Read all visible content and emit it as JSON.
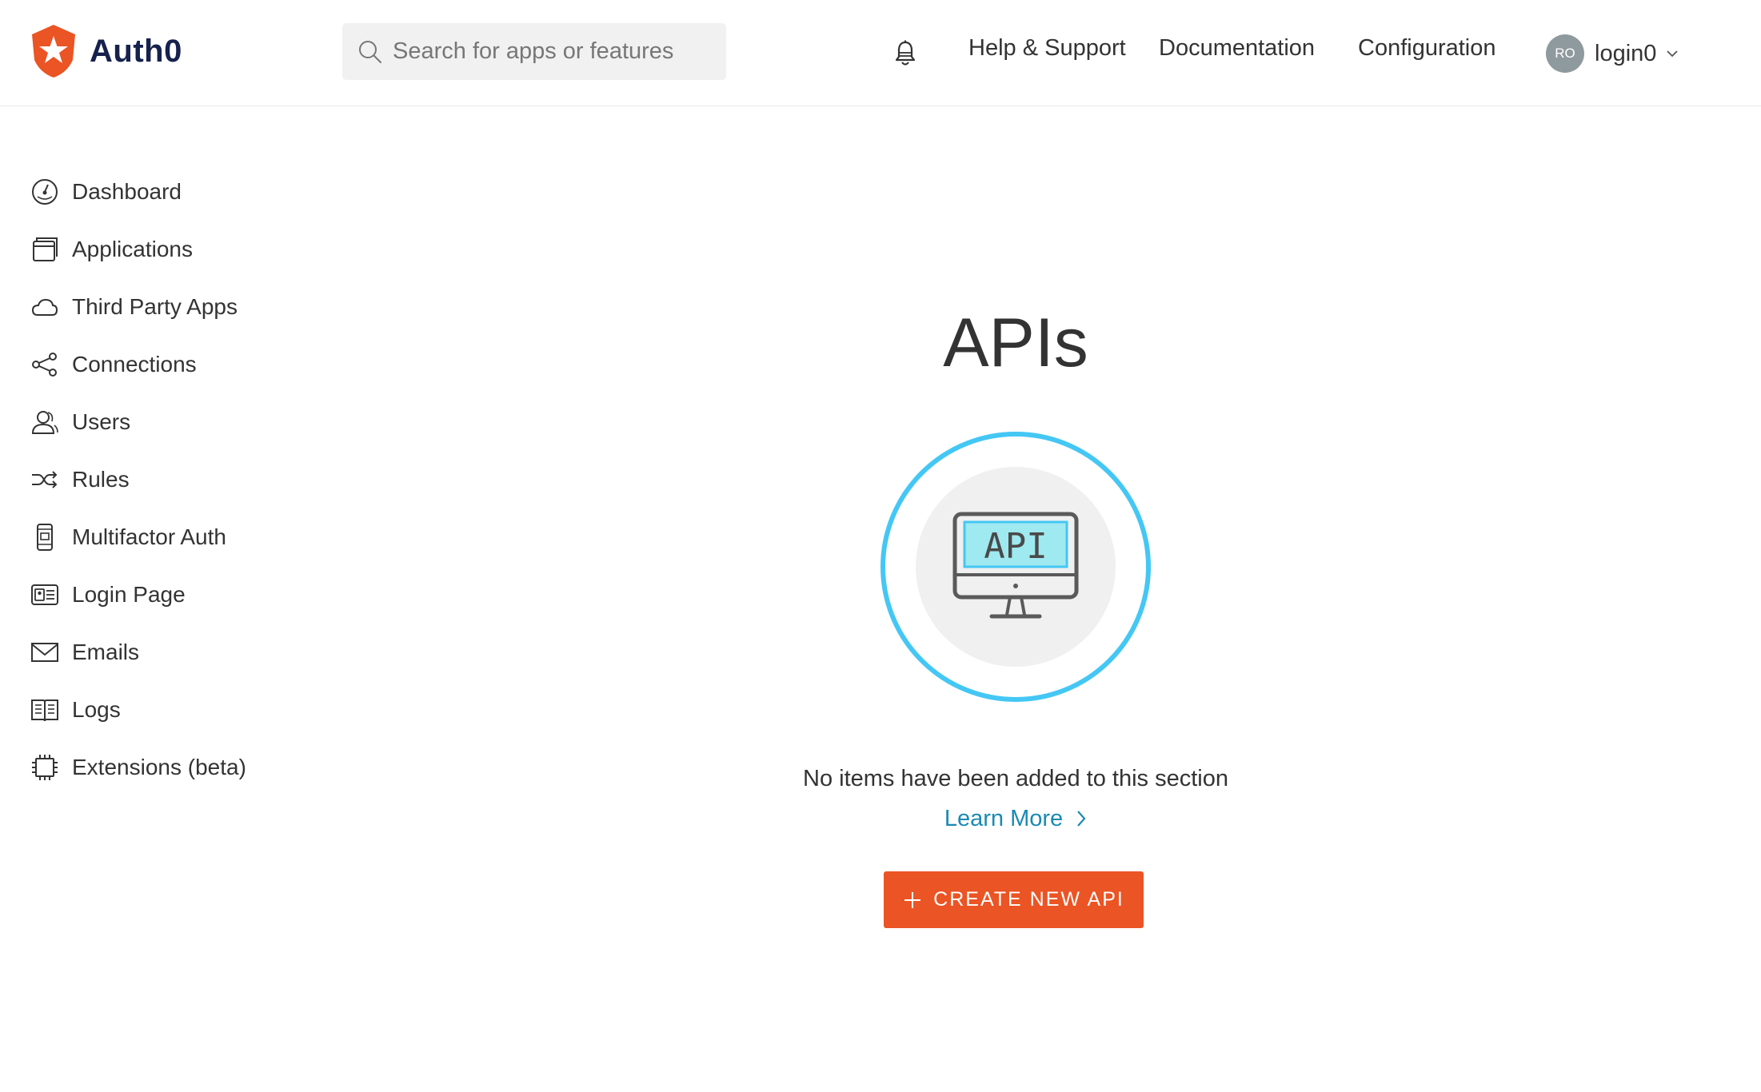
{
  "header": {
    "logo_text": "Auth0",
    "search_placeholder": "Search for apps or features",
    "nav": {
      "help": "Help & Support",
      "docs": "Documentation",
      "config": "Configuration"
    },
    "user": {
      "initials": "RO",
      "name": "login0"
    }
  },
  "sidebar": {
    "items": [
      {
        "label": "Dashboard",
        "icon": "dashboard-icon"
      },
      {
        "label": "Applications",
        "icon": "applications-icon"
      },
      {
        "label": "Third Party Apps",
        "icon": "cloud-icon"
      },
      {
        "label": "Connections",
        "icon": "connections-icon"
      },
      {
        "label": "Users",
        "icon": "users-icon"
      },
      {
        "label": "Rules",
        "icon": "rules-icon"
      },
      {
        "label": "Multifactor Auth",
        "icon": "phone-icon"
      },
      {
        "label": "Login Page",
        "icon": "login-page-icon"
      },
      {
        "label": "Emails",
        "icon": "email-icon"
      },
      {
        "label": "Logs",
        "icon": "logs-icon"
      },
      {
        "label": "Extensions (beta)",
        "icon": "extensions-icon"
      }
    ]
  },
  "main": {
    "title": "APIs",
    "illustration_text": "API",
    "empty_message": "No items have been added to this section",
    "learn_more": "Learn More",
    "create_button": "CREATE NEW API"
  },
  "colors": {
    "brand": "#eb5424",
    "link": "#1a8ab3",
    "ring": "#44c7f4",
    "logo_text": "#16214d"
  }
}
